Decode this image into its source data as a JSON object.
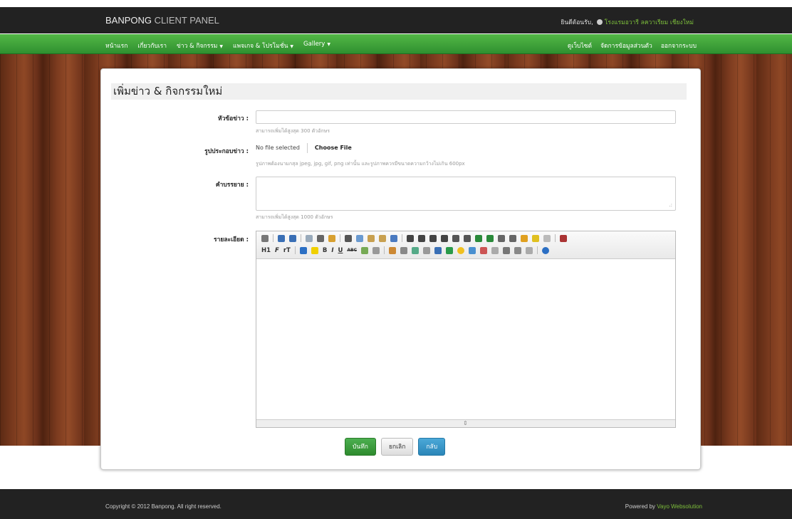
{
  "header": {
    "brand_a": "BANPONG",
    "brand_b": " CLIENT PANEL",
    "welcome_text": "ยินดีต้อนรับ,",
    "user_name": "โรงแรมอวารี ลควาเรียม เชียงใหม่"
  },
  "nav": {
    "items": [
      {
        "label": "หน้าแรก"
      },
      {
        "label": "เกี่ยวกับเรา"
      },
      {
        "label": "ข่าว & กิจกรรม",
        "dropdown": true
      },
      {
        "label": "แพจเกจ & โปรโมชั่น",
        "dropdown": true
      },
      {
        "label": "Gallery",
        "dropdown": true
      }
    ],
    "right": [
      "ดูเว็บไซต์",
      "จัดการข้อมูลส่วนตัว",
      "ออกจากระบบ"
    ]
  },
  "form": {
    "title": "เพิ่มข่าว & กิจกรรมใหม่",
    "title_label": "หัวข้อข่าว :",
    "title_help": "สามารถเพิ่มได้สูงสุด 300 ตัวอักษร",
    "image_label": "รูปประกอบข่าว :",
    "file_status": "No file selected",
    "file_button": "Choose File",
    "image_help": "รูปภาพต้องนามกสุล jpeg, jpg, gif, png เท่านั้น และรูปภาพควรมีขนาดความกว้างไม่เกิน 600px",
    "desc_label": "คำบรรยาย :",
    "desc_help": "สามารถเพิ่มได้สูงสุด 1000 ตัวอักษร",
    "detail_label": "รายละเอียด :"
  },
  "editor": {
    "format_label": "H1",
    "font_label": "F",
    "size_label": "rT",
    "bold": "B",
    "italic": "I",
    "underline": "U",
    "strike": "ABC"
  },
  "buttons": {
    "save": "บันทึก",
    "cancel": "ยกเลิก",
    "back": "กลับ"
  },
  "footer": {
    "copyright": "Copyright © 2012 Banpong. All right reserved.",
    "powered_prefix": "Powered by ",
    "powered_link": "Vayo Websolution"
  },
  "colors": {
    "nav_green": "#3aa53a",
    "link_green": "#7dbf3b",
    "save_button": "#3a9c3a",
    "back_button": "#2f8fc4"
  }
}
